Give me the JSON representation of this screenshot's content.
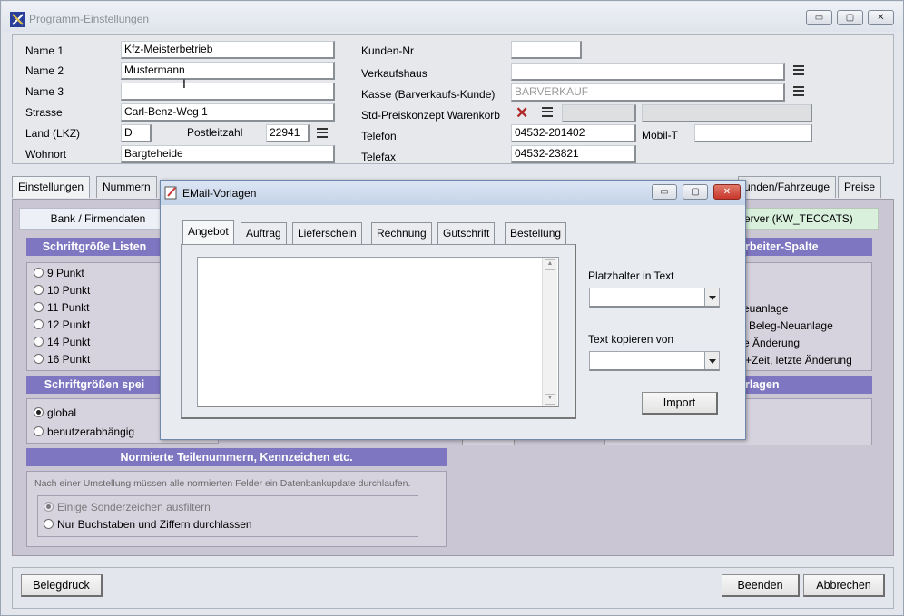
{
  "window": {
    "title": "Programm-Einstellungen",
    "buttons": {
      "minimize": "▭",
      "maximize": "▢",
      "close": "✕"
    }
  },
  "form": {
    "name1": {
      "label": "Name 1",
      "value": "Kfz-Meisterbetrieb"
    },
    "name2": {
      "label": "Name 2",
      "value": "Mustermann"
    },
    "name3": {
      "label": "Name 3",
      "value": ""
    },
    "strasse": {
      "label": "Strasse",
      "value": "Carl-Benz-Weg 1"
    },
    "land": {
      "label": "Land (LKZ)",
      "value": "D"
    },
    "plz": {
      "label": "Postleitzahl",
      "value": "22941"
    },
    "wohnort": {
      "label": "Wohnort",
      "value": "Bargteheide"
    },
    "kunden_nr": {
      "label": "Kunden-Nr",
      "value": ""
    },
    "verkaufshaus": {
      "label": "Verkaufshaus",
      "value": ""
    },
    "kasse": {
      "label": "Kasse (Barverkaufs-Kunde)",
      "value": "BARVERKAUF"
    },
    "preiskonzept": {
      "label": "Std-Preiskonzept Warenkorb",
      "value": ""
    },
    "telefon": {
      "label": "Telefon",
      "value": "04532-201402"
    },
    "mobil": {
      "label": "Mobil-T",
      "value": ""
    },
    "telefax": {
      "label": "Telefax",
      "value": "04532-23821"
    }
  },
  "tabs": {
    "einstellungen": "Einstellungen",
    "nummern": "Nummern",
    "kunden": "unden/Fahrzeuge",
    "preise": "Preise"
  },
  "left_panel": {
    "subtab": "Bank / Firmendaten",
    "schriftgroesse_header": "Schriftgröße Listen",
    "font_options": [
      "9 Punkt",
      "10 Punkt",
      "11 Punkt",
      "12 Punkt",
      "14 Punkt",
      "16 Punkt"
    ],
    "speichern_header": "Schriftgrößen spei",
    "global": "global",
    "benutzer": "benutzerabhängig",
    "normiert_header": "Normierte Teilenummern, Kennzeichen etc.",
    "normiert_note": "Nach einer Umstellung müssen alle normierten Felder ein Datenbankupdate durchlaufen.",
    "opt1": "Einige Sonderzeichen ausfiltern",
    "opt2": "Nur Buchstaben und Ziffern durchlassen"
  },
  "right_panel": {
    "subtab": "erver (KW_TECCATS)",
    "spalte_header": "rbeiter-Spalte",
    "items": [
      "euanlage",
      "Beleg-Neuanlage",
      "e Änderung",
      "+Zeit, letzte Änderung"
    ],
    "vorlagen_header": "rlagen"
  },
  "bottom": {
    "belegdruck": "Belegdruck",
    "beenden": "Beenden",
    "abbrechen": "Abbrechen"
  },
  "dialog": {
    "title": "EMail-Vorlagen",
    "tabs": [
      "Angebot",
      "Auftrag",
      "Lieferschein",
      "Rechnung",
      "Gutschrift",
      "Bestellung"
    ],
    "platzhalter_label": "Platzhalter in Text",
    "kopieren_label": "Text kopieren von",
    "import": "Import",
    "body": ""
  },
  "colors": {
    "header": "#7f76c2",
    "panel": "#cac6d4",
    "accent_close": "#c8372c"
  }
}
